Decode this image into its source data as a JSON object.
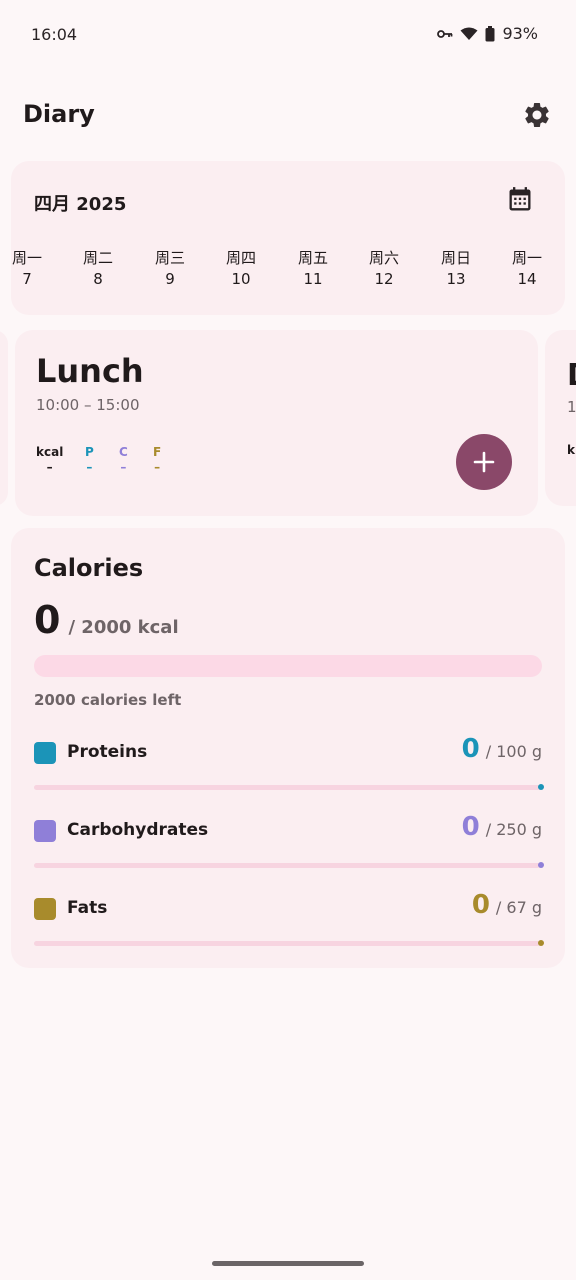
{
  "status": {
    "time": "16:04",
    "battery": "93%",
    "icons": [
      "vpn-key-icon",
      "wifi-icon",
      "battery-icon"
    ]
  },
  "appbar": {
    "title": "Diary",
    "settings_icon": "gear-icon"
  },
  "calendar": {
    "month": "四月 2025",
    "calendar_icon": "calendar-icon",
    "days": [
      {
        "name": "周一",
        "num": "7"
      },
      {
        "name": "周二",
        "num": "8"
      },
      {
        "name": "周三",
        "num": "9"
      },
      {
        "name": "周四",
        "num": "10"
      },
      {
        "name": "周五",
        "num": "11"
      },
      {
        "name": "周六",
        "num": "12"
      },
      {
        "name": "周日",
        "num": "13"
      },
      {
        "name": "周一",
        "num": "14"
      }
    ]
  },
  "meal": {
    "title": "Lunch",
    "time": "10:00 – 15:00",
    "macros": [
      {
        "label": "kcal",
        "value": "–",
        "color": "#201a1b"
      },
      {
        "label": "P",
        "value": "–",
        "color": "#1b94b8"
      },
      {
        "label": "C",
        "value": "–",
        "color": "#8f7fd8"
      },
      {
        "label": "F",
        "value": "–",
        "color": "#a88b2c"
      }
    ],
    "add_icon": "plus-icon"
  },
  "next_meal": {
    "title": "D",
    "time": "1",
    "kcal": "k"
  },
  "calories": {
    "title": "Calories",
    "consumed": "0",
    "goal": "/ 2000 kcal",
    "progress": 0,
    "left_text": "2000 calories left",
    "nutrients": [
      {
        "label": "Proteins",
        "value": "0",
        "goal": "/ 100 g",
        "color": "#1b94b8",
        "progress": 0
      },
      {
        "label": "Carbohydrates",
        "value": "0",
        "goal": "/ 250 g",
        "color": "#8f7fd8",
        "progress": 0
      },
      {
        "label": "Fats",
        "value": "0",
        "goal": "/ 67 g",
        "color": "#a88b2c",
        "progress": 0
      }
    ]
  },
  "colors": {
    "background": "#fdf7f8",
    "card": "#fbeef1",
    "accent": "#8a4869",
    "bar_track": "#fcd9e6"
  }
}
